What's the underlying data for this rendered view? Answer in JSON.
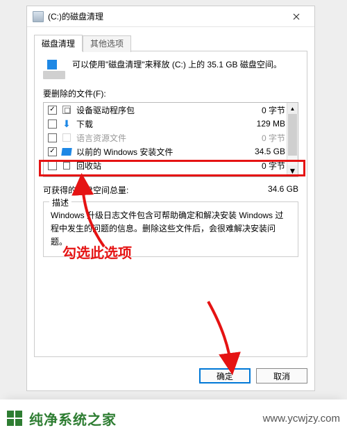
{
  "titlebar": {
    "title": "(C:)的磁盘清理"
  },
  "tabs": {
    "disk_cleanup": "磁盘清理",
    "other_options": "其他选项"
  },
  "intro": "可以使用\"磁盘清理\"来释放  (C:) 上的 35.1 GB 磁盘空间。",
  "files_label": "要删除的文件(F):",
  "files": [
    {
      "checked": true,
      "name": "设备驱动程序包",
      "size": "0 字节",
      "icon": "pkg",
      "disabled": false
    },
    {
      "checked": false,
      "name": "下载",
      "size": "129 MB",
      "icon": "dl",
      "disabled": false
    },
    {
      "checked": false,
      "name": "语言资源文件",
      "size": "0 字节",
      "icon": "lang",
      "disabled": true
    },
    {
      "checked": true,
      "name": "以前的 Windows 安装文件",
      "size": "34.5 GB",
      "icon": "win",
      "disabled": false
    },
    {
      "checked": false,
      "name": "回收站",
      "size": "0 字节",
      "icon": "bin",
      "disabled": false
    }
  ],
  "total": {
    "label": "可获得的磁盘空间总量:",
    "value": "34.6 GB"
  },
  "description": {
    "legend": "描述",
    "text": "Windows 升级日志文件包含可帮助确定和解决安装 Windows 过程中发生的问题的信息。删除这些文件后，会很难解决安装问题。"
  },
  "buttons": {
    "ok": "确定",
    "cancel": "取消"
  },
  "annotation": {
    "text": "勾选此选项"
  },
  "watermark": {
    "name": "纯净系统之家",
    "url": "www.ycwjzy.com"
  }
}
